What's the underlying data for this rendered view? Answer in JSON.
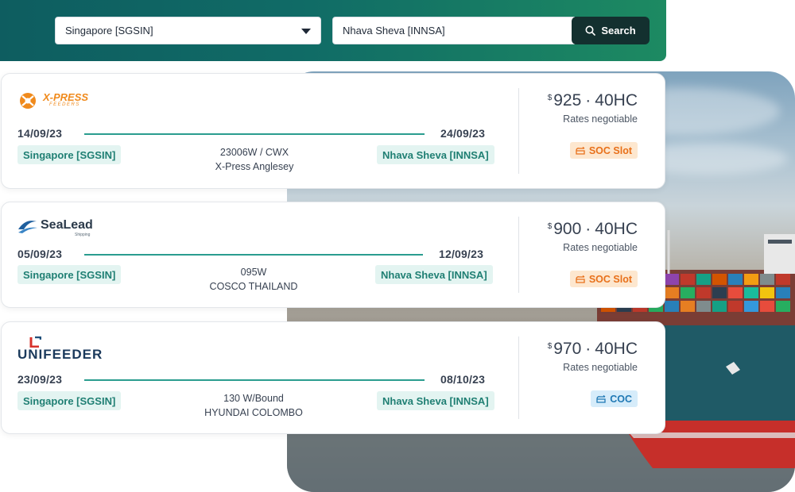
{
  "search": {
    "origin": "Singapore [SGSIN]",
    "destination": "Nhava Sheva [INNSA]",
    "button_label": "Search"
  },
  "results": [
    {
      "carrier": "X-PRESS FEEDERS",
      "logo_text": "X-PRESS",
      "logo_sub": "FEEDERS",
      "departure_date": "14/09/23",
      "arrival_date": "24/09/23",
      "origin_port": "Singapore [SGSIN]",
      "destination_port": "Nhava Sheva [INNSA]",
      "voyage": "23006W / CWX",
      "vessel": "X-Press Anglesey",
      "currency": "$",
      "price": "925",
      "container": "40HC",
      "rate_note": "Rates negotiable",
      "tag": "SOC Slot",
      "tag_color": "#e8701a"
    },
    {
      "carrier": "SeaLead Shipping",
      "logo_text": "SeaLead",
      "logo_sub": "Shipping",
      "departure_date": "05/09/23",
      "arrival_date": "12/09/23",
      "origin_port": "Singapore [SGSIN]",
      "destination_port": "Nhava Sheva [INNSA]",
      "voyage": "095W",
      "vessel": "COSCO THAILAND",
      "currency": "$",
      "price": "900",
      "container": "40HC",
      "rate_note": "Rates negotiable",
      "tag": "SOC Slot",
      "tag_color": "#e8701a"
    },
    {
      "carrier": "UNIFEEDER",
      "logo_text": "UNIFEEDER",
      "departure_date": "23/09/23",
      "arrival_date": "08/10/23",
      "origin_port": "Singapore [SGSIN]",
      "destination_port": "Nhava Sheva [INNSA]",
      "voyage": "130 W/Bound",
      "vessel": "HYUNDAI COLOMBO",
      "currency": "$",
      "price": "970",
      "container": "40HC",
      "rate_note": "Rates negotiable",
      "tag": "COC",
      "tag_color": "#1f78b4"
    }
  ],
  "colors": {
    "header_start": "#0e5d60",
    "header_end": "#1d8a62",
    "accent": "#2a9d8f",
    "search_button": "#13302f"
  },
  "icons": {
    "search": "search-icon",
    "dropdown": "chevron-down-icon",
    "soc": "container-icon",
    "coc": "container-icon"
  }
}
